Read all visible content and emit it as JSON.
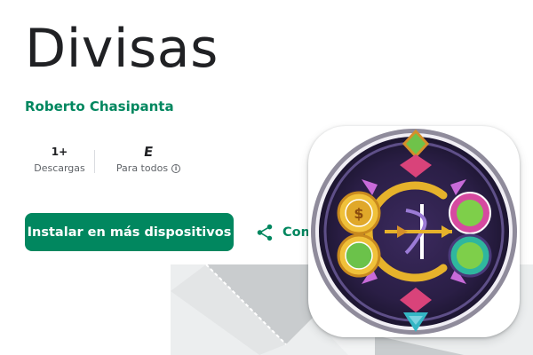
{
  "app": {
    "title": "Divisas",
    "developer": "Roberto Chasipanta"
  },
  "stats": {
    "downloads": {
      "value": "1+",
      "label": "Descargas"
    },
    "rating": {
      "value": "E",
      "label": "Para todos"
    }
  },
  "actions": {
    "install_label": "Instalar en más dispositivos",
    "share_label": "Com"
  },
  "icons": {
    "share": "share-icon",
    "info": "info-icon",
    "rating": "esrb-everyone-icon"
  },
  "colors": {
    "accent": "#01875f",
    "title": "#202124",
    "muted": "#5f6368"
  }
}
